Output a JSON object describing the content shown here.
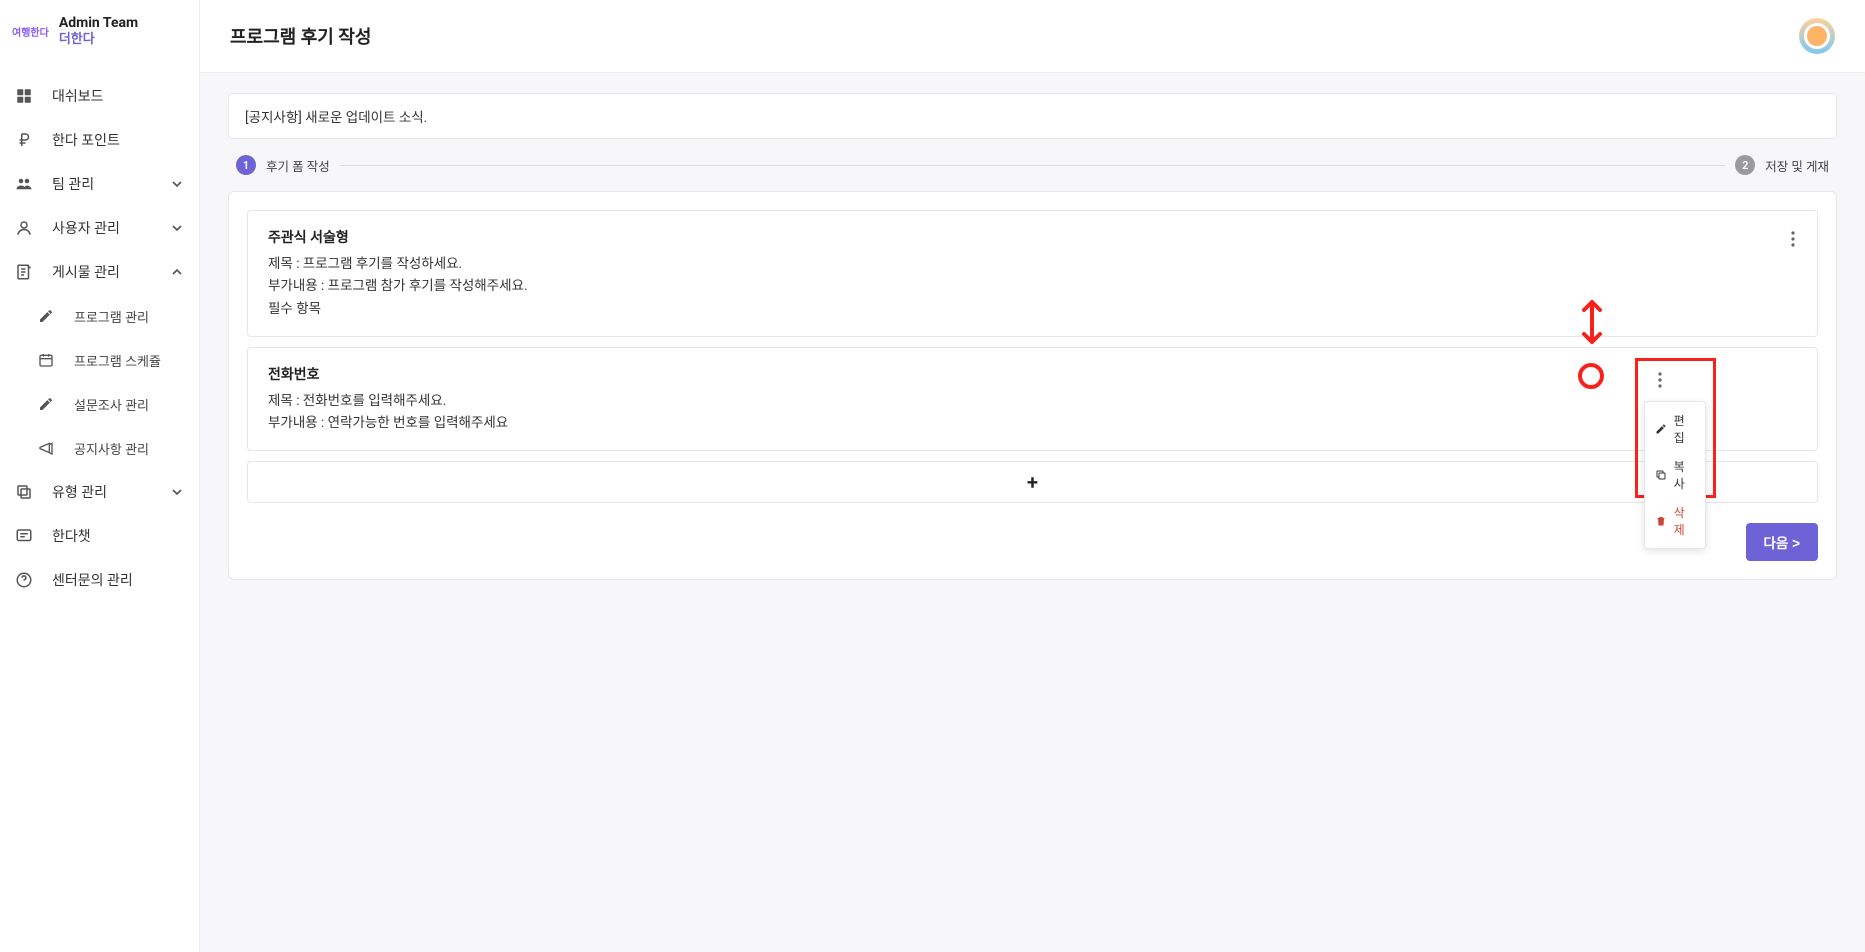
{
  "brand": {
    "logo_text": "여행한다",
    "title": "Admin Team",
    "subtitle": "더한다"
  },
  "sidebar": {
    "items": [
      {
        "label": "대쉬보드",
        "icon": "dashboard"
      },
      {
        "label": "한다 포인트",
        "icon": "ruble"
      },
      {
        "label": "팀 관리",
        "icon": "people",
        "expand": "down"
      },
      {
        "label": "사용자 관리",
        "icon": "person",
        "expand": "down"
      },
      {
        "label": "게시물 관리",
        "icon": "post",
        "expand": "up",
        "children": [
          {
            "label": "프로그램 관리",
            "icon": "pencil"
          },
          {
            "label": "프로그램 스케쥴",
            "icon": "calendar"
          },
          {
            "label": "설문조사 관리",
            "icon": "pencil"
          },
          {
            "label": "공지사항 관리",
            "icon": "megaphone"
          }
        ]
      },
      {
        "label": "유형 관리",
        "icon": "copies",
        "expand": "down"
      },
      {
        "label": "한다챗",
        "icon": "chat"
      },
      {
        "label": "센터문의 관리",
        "icon": "help"
      }
    ]
  },
  "header": {
    "title": "프로그램 후기 작성"
  },
  "notice": {
    "text": "[공지사항] 새로운 업데이트 소식."
  },
  "stepper": {
    "steps": [
      {
        "num": "1",
        "label": "후기 폼 작성",
        "active": true
      },
      {
        "num": "2",
        "label": "저장 및 게재",
        "active": false
      }
    ]
  },
  "questions": [
    {
      "type_label": "주관식 서술형",
      "title_line": "제목 : 프로그램 후기를 작성하세요.",
      "detail_line": "부가내용 : 프로그램 참가 후기를 작성해주세요.",
      "required_line": "필수 항목"
    },
    {
      "type_label": "전화번호",
      "title_line": "제목 : 전화번호를 입력해주세요.",
      "detail_line": "부가내용 : 연락가능한 번호를 입력해주세요",
      "required_line": ""
    }
  ],
  "popup": {
    "edit": "편집",
    "copy": "복사",
    "delete": "삭제"
  },
  "buttons": {
    "next": "다음 >",
    "add": "+"
  }
}
